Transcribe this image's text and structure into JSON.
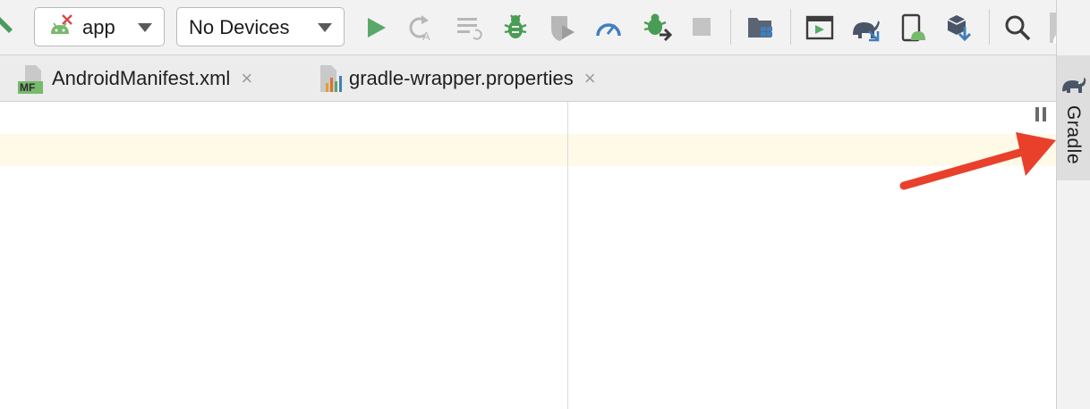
{
  "toolbar": {
    "run_config": {
      "label": "app",
      "icon": "android-config-error-icon"
    },
    "device_selector": {
      "label": "No Devices"
    },
    "actions": [
      {
        "name": "hammer-icon",
        "tooltip": ""
      },
      {
        "name": "run-icon"
      },
      {
        "name": "apply-changes-icon"
      },
      {
        "name": "apply-code-changes-icon"
      },
      {
        "name": "debug-icon"
      },
      {
        "name": "run-with-coverage-icon"
      },
      {
        "name": "profile-icon"
      },
      {
        "name": "attach-debugger-icon"
      },
      {
        "name": "stop-icon"
      },
      {
        "name": "project-structure-icon"
      },
      {
        "name": "run-anything-icon"
      },
      {
        "name": "sync-gradle-icon"
      },
      {
        "name": "avd-manager-icon"
      },
      {
        "name": "sdk-manager-icon"
      },
      {
        "name": "search-icon"
      },
      {
        "name": "avatar-icon"
      }
    ]
  },
  "tabs": [
    {
      "label": "AndroidManifest.xml",
      "icon": "manifest-file-icon",
      "icon_text": "MF"
    },
    {
      "label": "gradle-wrapper.properties",
      "icon": "properties-file-icon"
    }
  ],
  "tab_close_glyph": "×",
  "right_strip": {
    "label": "Gradle",
    "icon": "gradle-elephant-icon"
  },
  "colors": {
    "run_green": "#59a869",
    "debug_green": "#499c54",
    "profile_blue": "#3f7fbf",
    "arrow_red": "#e8402b",
    "highlight": "#fffae8"
  }
}
